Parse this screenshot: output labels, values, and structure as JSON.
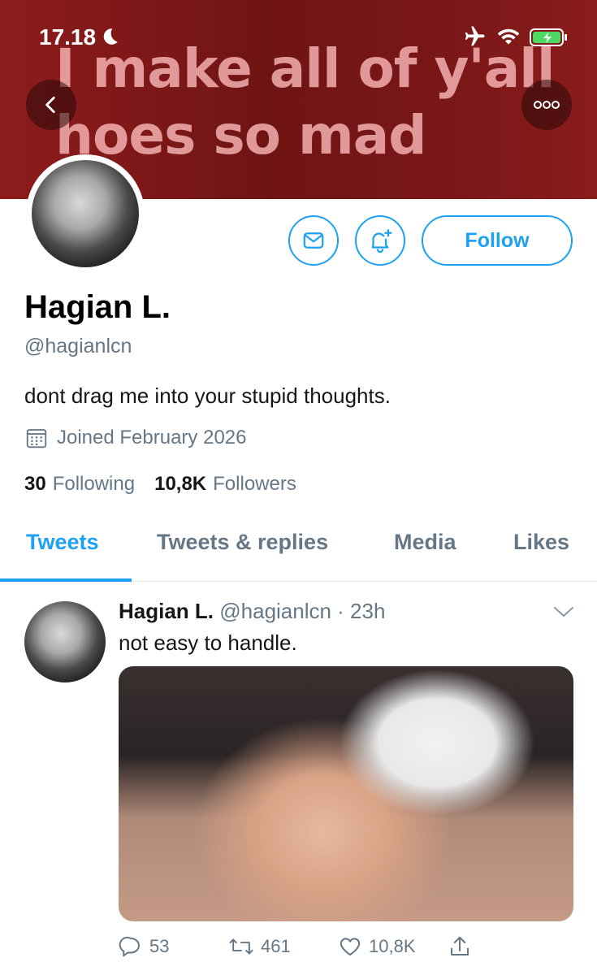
{
  "status_bar": {
    "time": "17.18"
  },
  "banner": {
    "text": "I make all of y'all hoes so mad"
  },
  "profile": {
    "name": "Hagian L.",
    "handle": "@hagianlcn",
    "bio": "dont drag me into your stupid thoughts.",
    "joined": "Joined February 2026",
    "following_count": "30",
    "following_label": "Following",
    "followers_count": "10,8K",
    "followers_label": "Followers",
    "follow_label": "Follow"
  },
  "tabs": [
    {
      "label": "Tweets",
      "active": true
    },
    {
      "label": "Tweets & replies"
    },
    {
      "label": "Media"
    },
    {
      "label": "Likes"
    }
  ],
  "tweet": {
    "name": "Hagian L.",
    "meta": "@hagianlcn · 23h",
    "text": "not easy to handle.",
    "replies": "53",
    "retweets": "461",
    "likes": "10,8K"
  },
  "colors": {
    "accent": "#1da1f2",
    "muted": "#657786",
    "banner": "#7a1717"
  }
}
